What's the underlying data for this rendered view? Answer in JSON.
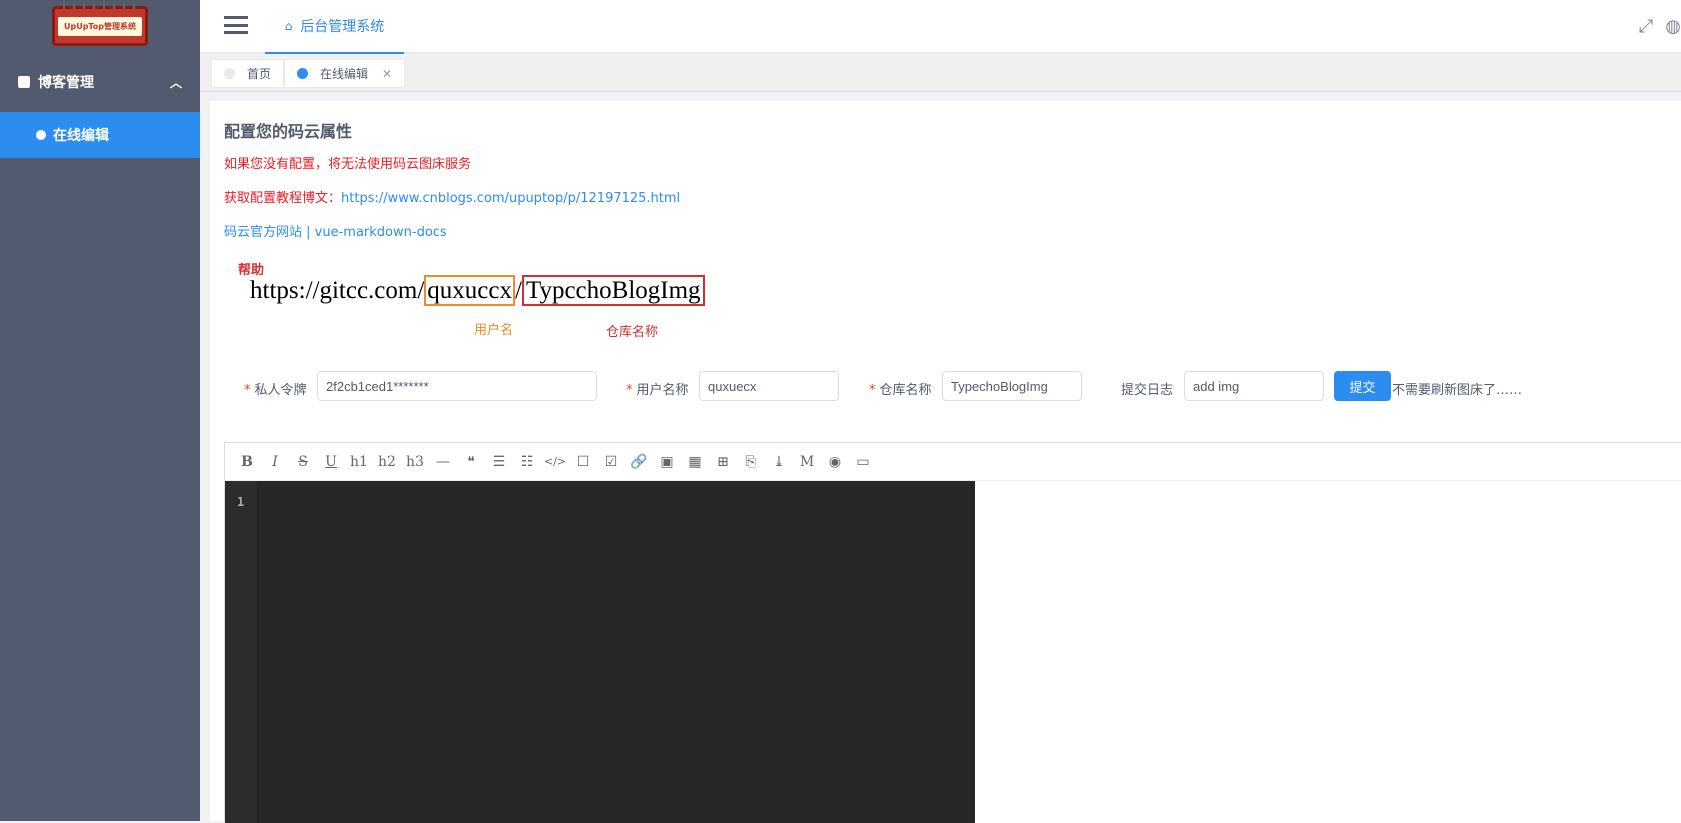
{
  "sidebar": {
    "logo_text": "UpUpTop管理系统",
    "group_label": "博客管理",
    "item_label": "在线编辑"
  },
  "header": {
    "tab_label": "后台管理系统"
  },
  "tabs": [
    {
      "label": "首页",
      "dot_color": "#e8eaec"
    },
    {
      "label": "在线编辑",
      "dot_color": "#2d8cf0"
    }
  ],
  "content": {
    "title": "配置您的码云属性",
    "warning": "如果您没有配置，将无法使用码云图床服务",
    "tutorial_prefix": "获取配置教程博文：",
    "tutorial_link": "https://www.cnblogs.com/upuptop/p/12197125.html",
    "link_gitee": "码云官方网站",
    "link_sep": " | ",
    "link_docs": "vue-markdown-docs"
  },
  "help": {
    "title": "帮助",
    "url_prefix": "https://gitcc.com/",
    "url_user": "quxuccx",
    "url_slash": "/",
    "url_repo": "TypcchoBlogImg",
    "label_user": "用户名",
    "label_repo": "仓库名称"
  },
  "form": {
    "token_label": "私人令牌",
    "token_value": "2f2cb1ced1*******",
    "user_label": "用户名称",
    "user_value": "quxuecx",
    "repo_label": "仓库名称",
    "repo_value": "TypechoBlogImg",
    "log_label": "提交日志",
    "log_value": "add img",
    "submit_label": "提交",
    "tip": "不需要刷新图床了……"
  },
  "editor": {
    "line_number": "1",
    "toolbar": [
      "B",
      "I",
      "S",
      "U",
      "h1",
      "h2",
      "h3",
      "—",
      "❝",
      "☰",
      "☷",
      "</>",
      "☐",
      "☑",
      "🔗",
      "▣",
      "▦",
      "⊞",
      "⎘",
      "⤓",
      "M",
      "◉",
      "▭"
    ]
  }
}
